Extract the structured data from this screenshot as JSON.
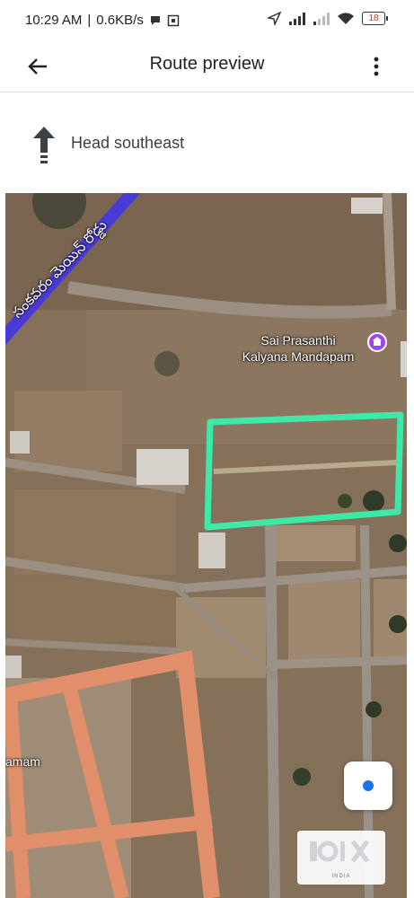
{
  "status_bar": {
    "time": "10:29 AM",
    "speed": "0.6KB/s",
    "battery": "18",
    "battery_color": "#d93025"
  },
  "app_bar": {
    "title": "Route preview",
    "back_icon": "arrow-left-icon",
    "menu_icon": "more-vert-icon"
  },
  "direction": {
    "text": "Head southeast",
    "icon": "arrow-up-icon"
  },
  "map": {
    "poi": {
      "name_line1": "Sai Prasanthi",
      "name_line2": "Kalyana Mandapam",
      "pin_color": "#a142f4"
    },
    "road_label": "సంకవరం మెయిన్ రోడ్డు",
    "edge_label": "amam",
    "highlight_color": "#3ee8a6",
    "route_color": "#4b3bd6",
    "locate_icon": "my-location-icon",
    "watermark_subtext": "INDIA"
  }
}
